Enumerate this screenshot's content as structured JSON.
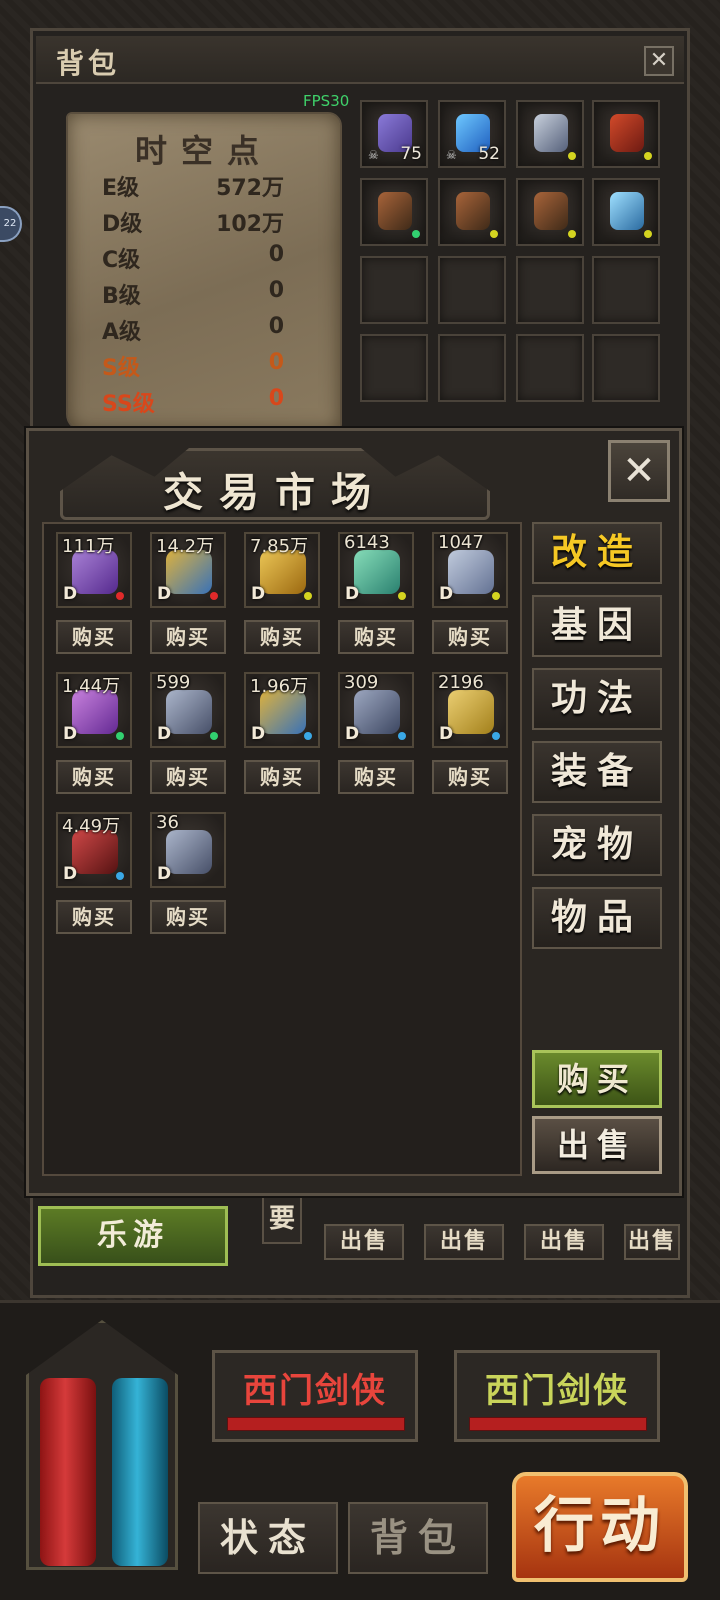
{
  "fps": "FPS30",
  "side_badge": "22",
  "backpack": {
    "title": "背包",
    "close": "✕",
    "parchment": {
      "title": "时空点",
      "grades": [
        {
          "grade": "E级",
          "value": "572万",
          "color": "#2f271e"
        },
        {
          "grade": "D级",
          "value": "102万",
          "color": "#2f271e"
        },
        {
          "grade": "C级",
          "value": "0",
          "color": "#2f271e"
        },
        {
          "grade": "B级",
          "value": "0",
          "color": "#2f271e"
        },
        {
          "grade": "A级",
          "value": "0",
          "color": "#2f271e"
        },
        {
          "grade": "S级",
          "value": "0",
          "color": "#c4591a"
        },
        {
          "grade": "SS级",
          "value": "0",
          "color": "#d8471b"
        }
      ]
    },
    "slots": [
      {
        "icon": "purple-gem-icon",
        "count": "75",
        "skull": "☠"
      },
      {
        "icon": "blue-gem-icon",
        "count": "52",
        "skull": "☠"
      },
      {
        "icon": "helmet-icon",
        "dot": "#d4d420"
      },
      {
        "icon": "armor-icon",
        "dot": "#d4d420"
      },
      {
        "icon": "boots-icon",
        "dot": "#32d070"
      },
      {
        "icon": "boots-icon",
        "dot": "#d4d420"
      },
      {
        "icon": "boots-icon",
        "dot": "#d4d420"
      },
      {
        "icon": "blade-icon",
        "dot": "#d4d420"
      }
    ],
    "lower": {
      "leyou": "乐游",
      "yao": "要",
      "sell_labels": [
        "出售",
        "出售",
        "出售",
        "出售"
      ]
    }
  },
  "market": {
    "title": "交易市场",
    "close": "✕",
    "items": [
      {
        "price": "111万",
        "grade": "D",
        "icon": "purple-book-icon",
        "dot": "#e02a2a"
      },
      {
        "price": "14.2万",
        "grade": "D",
        "icon": "gauntlet-icon",
        "dot": "#e02a2a"
      },
      {
        "price": "7.85万",
        "grade": "D",
        "icon": "gold-armor-icon",
        "dot": "#d4d420"
      },
      {
        "price": "6143",
        "grade": "D",
        "icon": "device-icon",
        "dot": "#d4d420"
      },
      {
        "price": "1047",
        "grade": "D",
        "icon": "shoulder-icon",
        "dot": "#d4d420"
      },
      {
        "price": "1.44万",
        "grade": "D",
        "icon": "purple-ring-icon",
        "dot": "#32d070"
      },
      {
        "price": "599",
        "grade": "D",
        "icon": "arm-icon",
        "dot": "#32d070"
      },
      {
        "price": "1.96万",
        "grade": "D",
        "icon": "gauntlet-icon",
        "dot": "#3aa8e6"
      },
      {
        "price": "309",
        "grade": "D",
        "icon": "legs-icon",
        "dot": "#3aa8e6"
      },
      {
        "price": "2196",
        "grade": "D",
        "icon": "gold-book-icon",
        "dot": "#3aa8e6"
      },
      {
        "price": "4.49万",
        "grade": "D",
        "icon": "red-armor-icon",
        "dot": "#3aa8e6"
      },
      {
        "price": "36",
        "grade": "D",
        "icon": "arm-icon",
        "dot": ""
      }
    ],
    "buy_label": "购买",
    "categories": [
      "改造",
      "基因",
      "功法",
      "装备",
      "宠物",
      "物品"
    ],
    "active_category": "改造",
    "actions": {
      "buy": "购买",
      "sell": "出售"
    }
  },
  "hud": {
    "names": [
      {
        "text": "西门剑侠",
        "color": "#e8453c"
      },
      {
        "text": "西门剑侠",
        "color": "#c9d45a"
      }
    ],
    "tabs": [
      "状态",
      "背包"
    ],
    "action": "行动"
  }
}
